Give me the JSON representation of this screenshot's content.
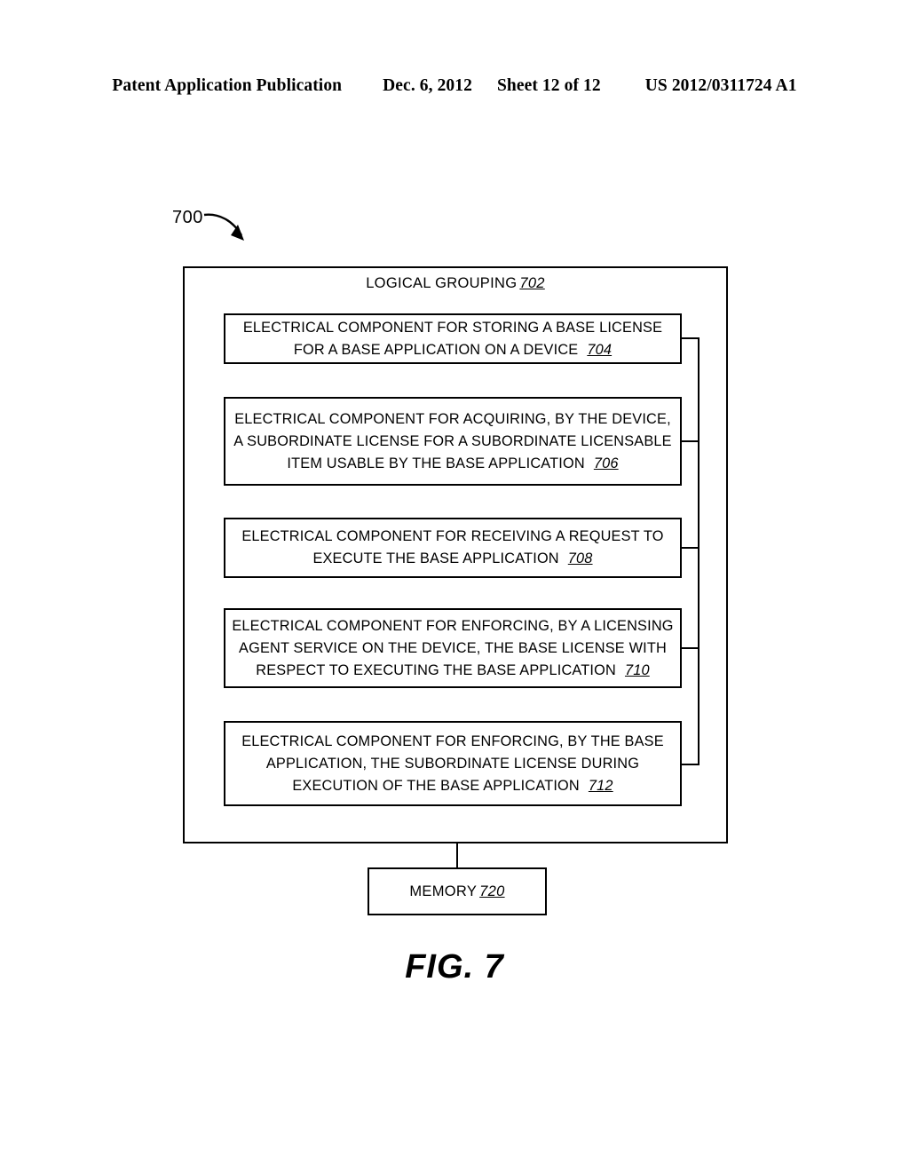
{
  "header": {
    "publication": "Patent Application Publication",
    "date": "Dec. 6, 2012",
    "sheet": "Sheet 12 of 12",
    "patent_number": "US 2012/0311724 A1"
  },
  "figure": {
    "ref_label": "700",
    "caption": "FIG. 7",
    "outer_box": {
      "title": "LOGICAL GROUPING",
      "ref": "702"
    },
    "memory_box": {
      "label": "MEMORY",
      "ref": "720"
    },
    "components": [
      {
        "ref": "704",
        "lines": [
          "ELECTRICAL COMPONENT FOR STORING A BASE LICENSE",
          "FOR A BASE APPLICATION ON A DEVICE"
        ]
      },
      {
        "ref": "706",
        "lines": [
          "ELECTRICAL COMPONENT FOR ACQUIRING, BY THE DEVICE,",
          "A SUBORDINATE LICENSE FOR A SUBORDINATE LICENSABLE",
          "ITEM USABLE BY THE BASE APPLICATION"
        ]
      },
      {
        "ref": "708",
        "lines": [
          "ELECTRICAL COMPONENT FOR RECEIVING A REQUEST TO",
          "EXECUTE THE BASE APPLICATION"
        ]
      },
      {
        "ref": "710",
        "lines": [
          "ELECTRICAL COMPONENT FOR ENFORCING, BY A LICENSING",
          "AGENT SERVICE ON THE DEVICE, THE BASE LICENSE WITH",
          "RESPECT TO EXECUTING THE BASE APPLICATION"
        ]
      },
      {
        "ref": "712",
        "lines": [
          "ELECTRICAL COMPONENT FOR ENFORCING, BY THE BASE",
          "APPLICATION, THE SUBORDINATE LICENSE DURING",
          "EXECUTION OF THE BASE APPLICATION"
        ]
      }
    ]
  },
  "colors": {
    "ink": "#000000",
    "paper": "#ffffff"
  }
}
